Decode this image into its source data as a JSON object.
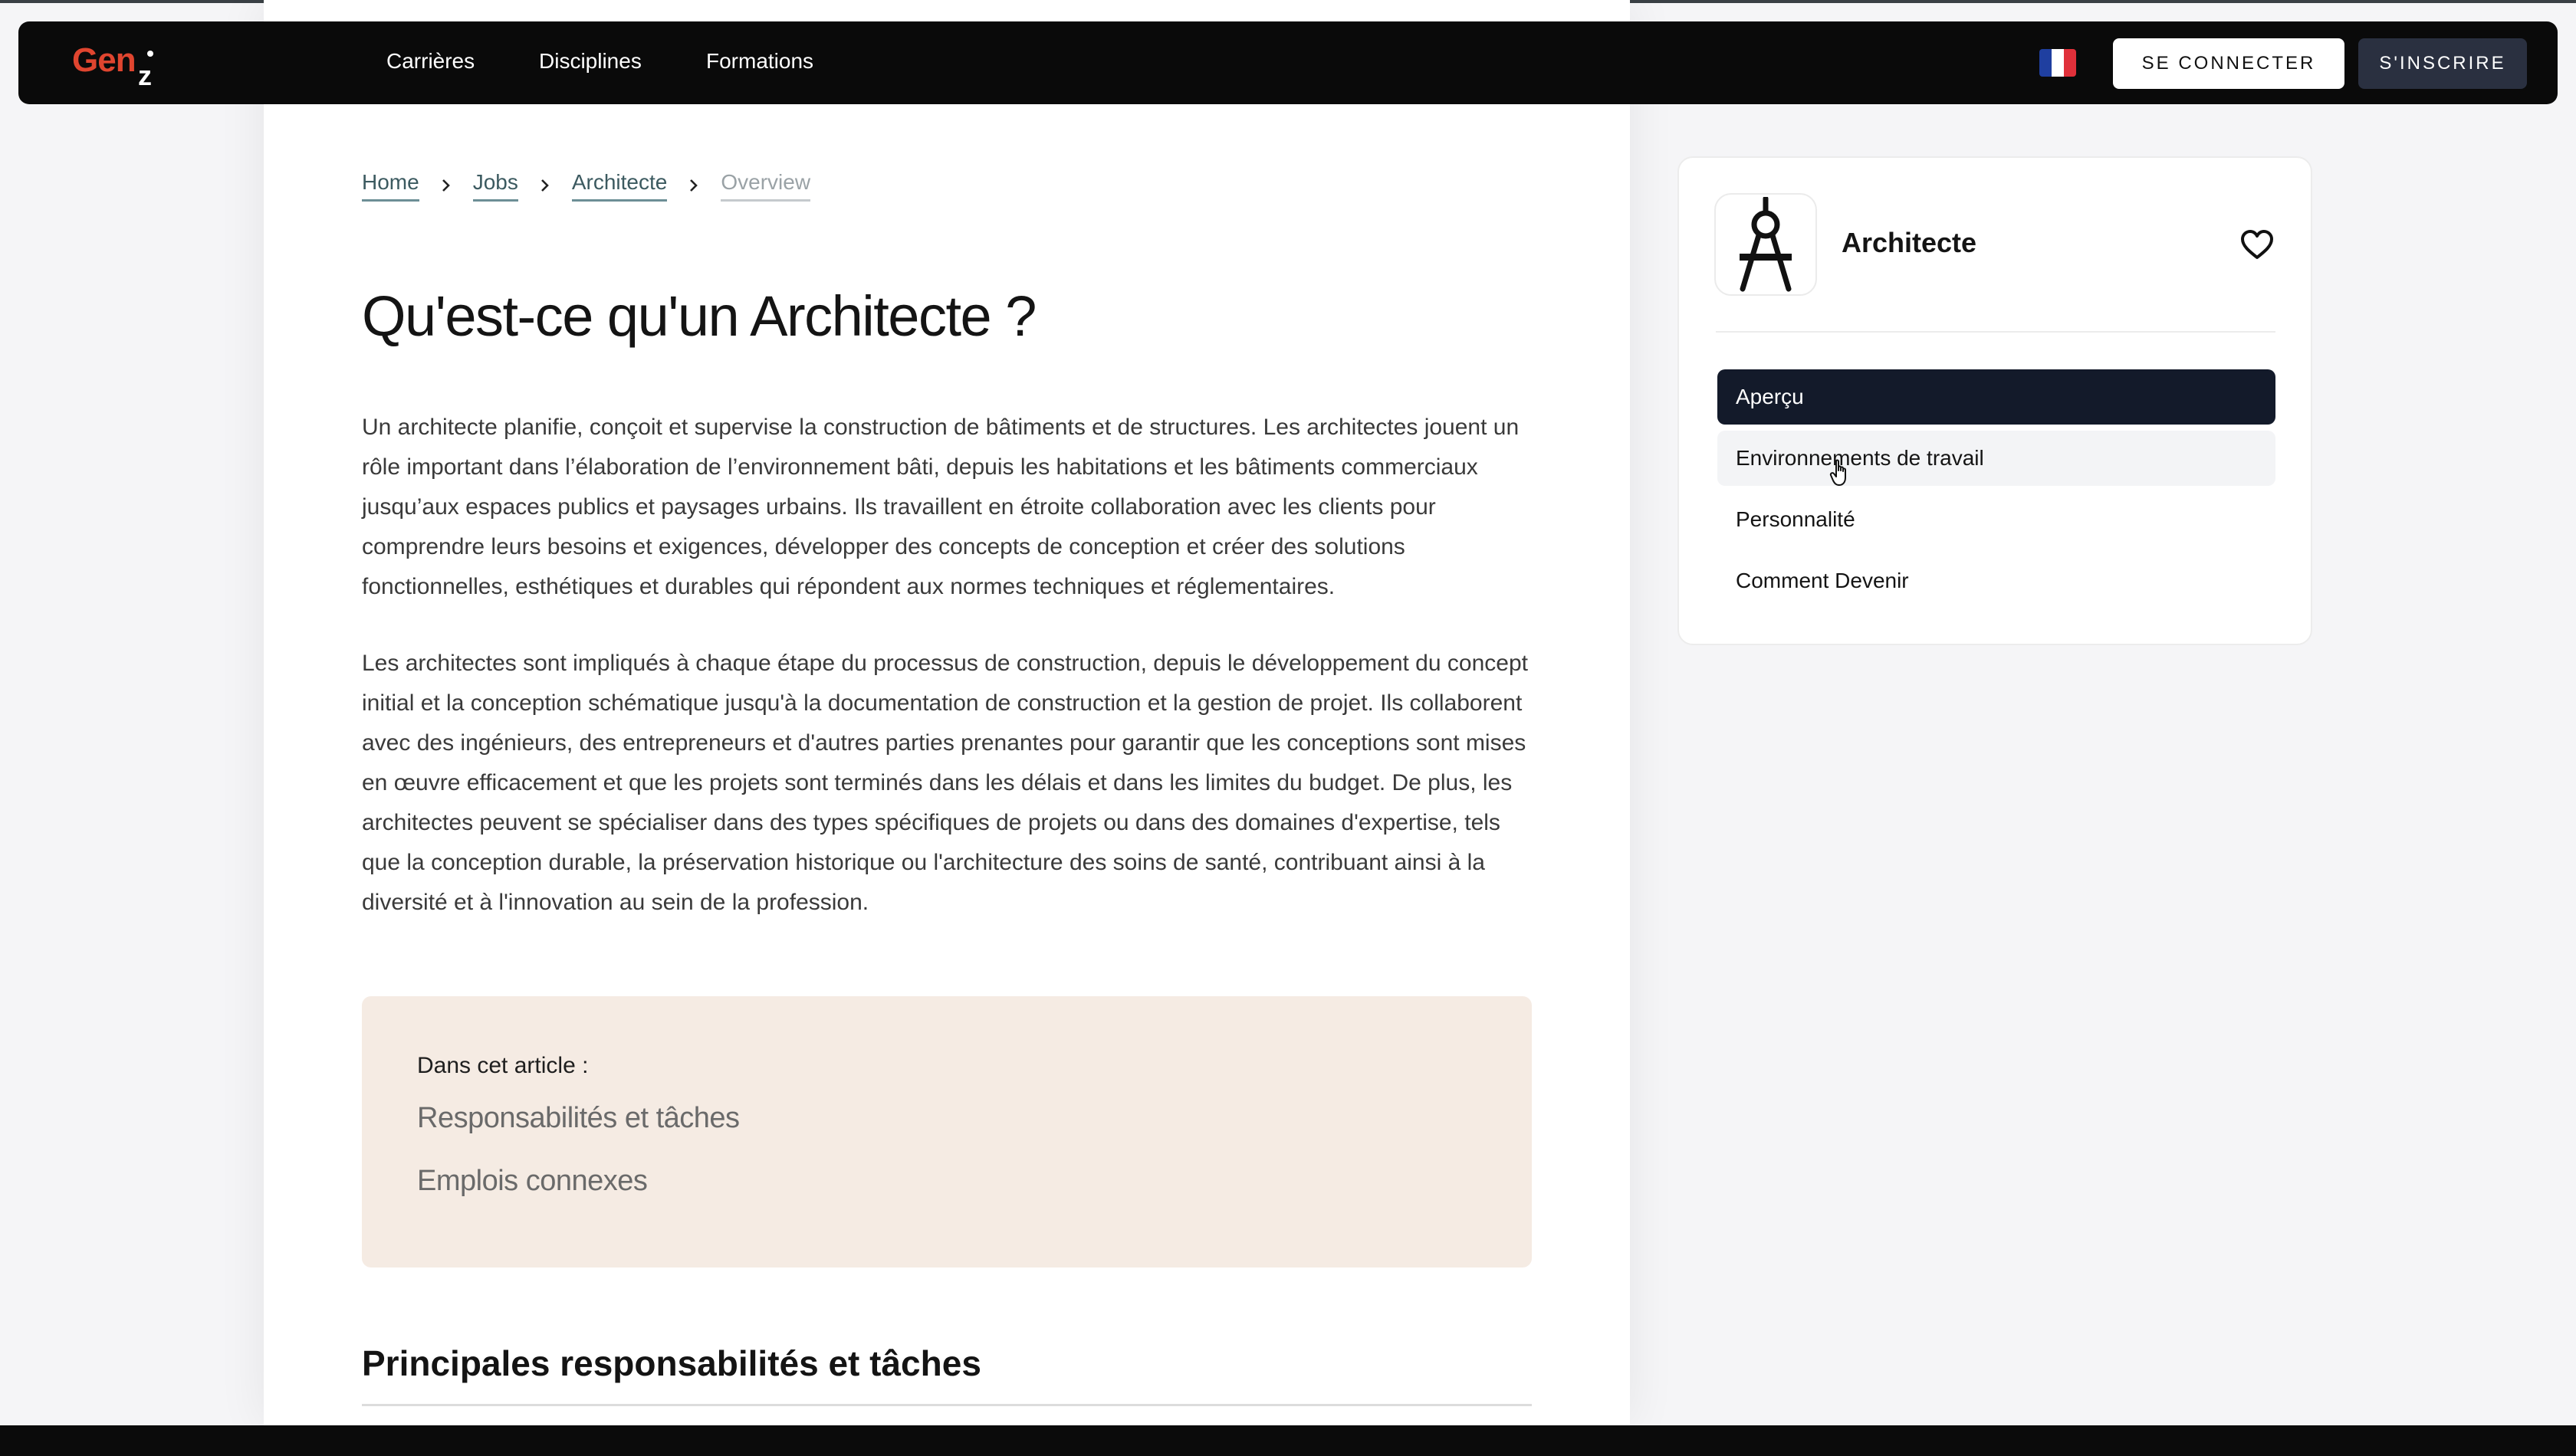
{
  "brand": {
    "logo_main": "Gen",
    "logo_sub": "z",
    "logo_color": "#e0452f"
  },
  "nav": {
    "links": [
      "Carrières",
      "Disciplines",
      "Formations"
    ],
    "language_flag": "flag-fr-icon",
    "login_label": "SE CONNECTER",
    "signup_label": "S'INSCRIRE"
  },
  "breadcrumb": {
    "items": [
      "Home",
      "Jobs",
      "Architecte",
      "Overview"
    ]
  },
  "article": {
    "title": "Qu'est-ce qu'un Architecte ?",
    "paragraph1": "Un architecte planifie, conçoit et supervise la construction de bâtiments et de structures. Les architectes jouent un rôle important dans l’élaboration de l’environnement bâti, depuis les habitations et les bâtiments commerciaux jusqu’aux espaces publics et paysages urbains. Ils travaillent en étroite collaboration avec les clients pour comprendre leurs besoins et exigences, développer des concepts de conception et créer des solutions fonctionnelles, esthétiques et durables qui répondent aux normes techniques et réglementaires.",
    "paragraph2": "Les architectes sont impliqués à chaque étape du processus de construction, depuis le développement du concept initial et la conception schématique jusqu'à la documentation de construction et la gestion de projet. Ils collaborent avec des ingénieurs, des entrepreneurs et d'autres parties prenantes pour garantir que les conceptions sont mises en œuvre efficacement et que les projets sont terminés dans les délais et dans les limites du budget. De plus, les architectes peuvent se spécialiser dans des types spécifiques de projets ou dans des domaines d'expertise, tels que la conception durable, la préservation historique ou l'architecture des soins de santé, contribuant ainsi à la diversité et à l'innovation au sein de la profession.",
    "toc": {
      "heading": "Dans cet article :",
      "links": [
        "Responsabilités et tâches",
        "Emplois connexes"
      ],
      "background": "#f5ebe3"
    },
    "section_title": "Principales responsabilités et tâches"
  },
  "sidebar": {
    "job_title": "Architecte",
    "job_icon": "compass-drafting-icon",
    "favorite_icon": "heart-outline-icon",
    "menu": [
      "Aperçu",
      "Environnements de travail",
      "Personnalité",
      "Comment Devenir"
    ],
    "active_index": 0,
    "active_color": "#131a2a"
  }
}
